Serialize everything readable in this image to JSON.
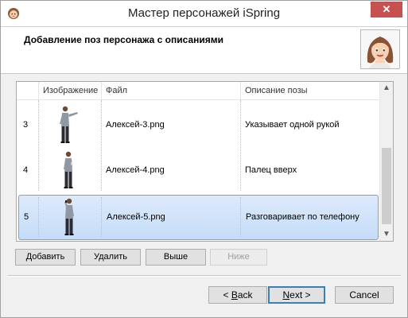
{
  "window": {
    "title": "Мастер персонажей iSpring",
    "close_glyph": "✕",
    "app_icon": "character-face-icon"
  },
  "header": {
    "title": "Добавление поз персонажа с описаниями",
    "avatar_icon": "female-character-avatar"
  },
  "table": {
    "columns": [
      "Изображение",
      "Файл",
      "Описание позы"
    ],
    "rows": [
      {
        "num": "3",
        "file": "Алексей-3.png",
        "description": "Указывает одной рукой",
        "selected": false
      },
      {
        "num": "4",
        "file": "Алексей-4.png",
        "description": "Палец вверх",
        "selected": false
      },
      {
        "num": "5",
        "file": "Алексей-5.png",
        "description": "Разговаривает по телефону",
        "selected": true
      }
    ],
    "scroll_up_glyph": "▲",
    "scroll_down_glyph": "▼"
  },
  "actions": {
    "add": "Добавить",
    "delete": "Удалить",
    "up": "Выше",
    "down": "Ниже"
  },
  "nav": {
    "back_prefix": "< ",
    "back_underlined": "B",
    "back_rest": "ack",
    "next_underlined": "N",
    "next_rest": "ext >",
    "cancel": "Cancel"
  },
  "colors": {
    "selection": "#c5dcf8",
    "close_button": "#c75050",
    "default_button_border": "#3c7fb1"
  }
}
